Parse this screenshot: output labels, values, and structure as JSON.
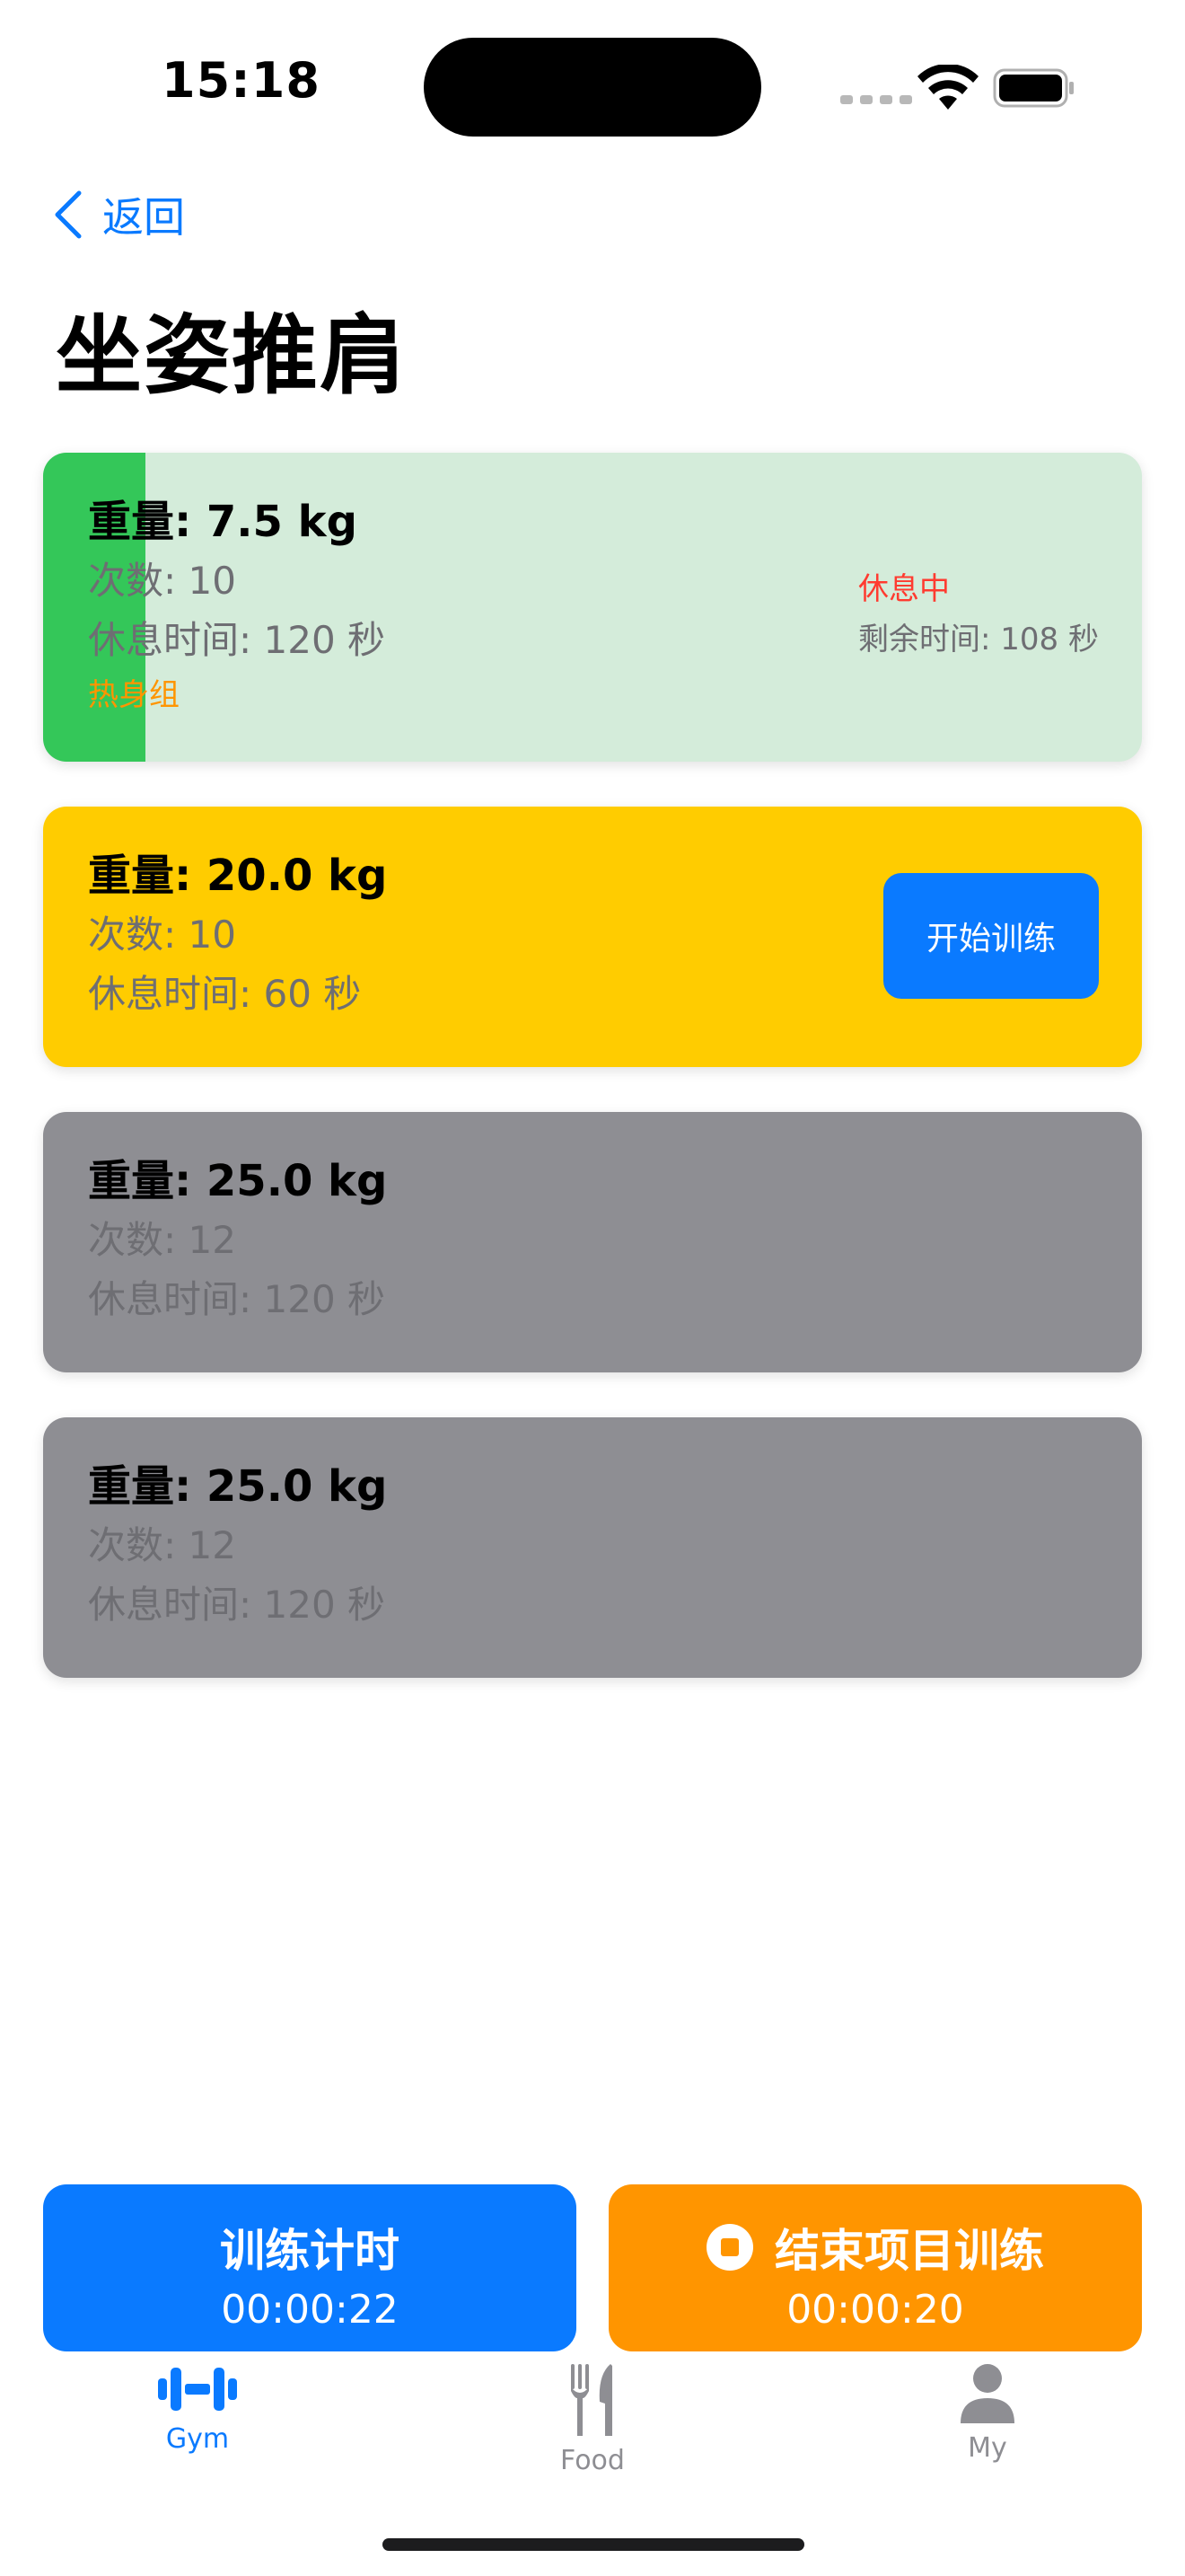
{
  "status_bar": {
    "time": "15:18"
  },
  "nav": {
    "back_label": "返回"
  },
  "page": {
    "title": "坐姿推肩"
  },
  "sets": [
    {
      "weight": "重量: 7.5 kg",
      "reps": "次数: 10",
      "rest": "休息时间: 120 秒",
      "tag": "热身组",
      "status": "休息中",
      "remaining": "剩余时间: 108 秒",
      "state": "resting",
      "background": "#d4ecda"
    },
    {
      "weight": "重量: 20.0 kg",
      "reps": "次数: 10",
      "rest": "休息时间: 60 秒",
      "action_label": "开始训练",
      "state": "current",
      "background": "#ffcc00"
    },
    {
      "weight": "重量: 25.0 kg",
      "reps": "次数: 12",
      "rest": "休息时间: 120 秒",
      "state": "pending",
      "background": "#8e8e93"
    },
    {
      "weight": "重量: 25.0 kg",
      "reps": "次数: 12",
      "rest": "休息时间: 120 秒",
      "state": "pending",
      "background": "#8e8e93"
    }
  ],
  "bottom_buttons": {
    "workout_timer": {
      "label": "训练计时",
      "time": "00:00:22",
      "color": "#0a7aff"
    },
    "end_exercise": {
      "label": "结束项目训练",
      "time": "00:00:20",
      "color": "#ff9500",
      "icon": "stop-circle-icon"
    }
  },
  "tabs": [
    {
      "label": "Gym",
      "icon": "dumbbell-icon",
      "active": true
    },
    {
      "label": "Food",
      "icon": "fork-knife-icon",
      "active": false
    },
    {
      "label": "My",
      "icon": "person-icon",
      "active": false
    }
  ],
  "colors": {
    "accent": "#0a7aff",
    "inactive_tab": "#8e8e93",
    "warning": "#ff3b30",
    "warmup": "#ff9500"
  }
}
